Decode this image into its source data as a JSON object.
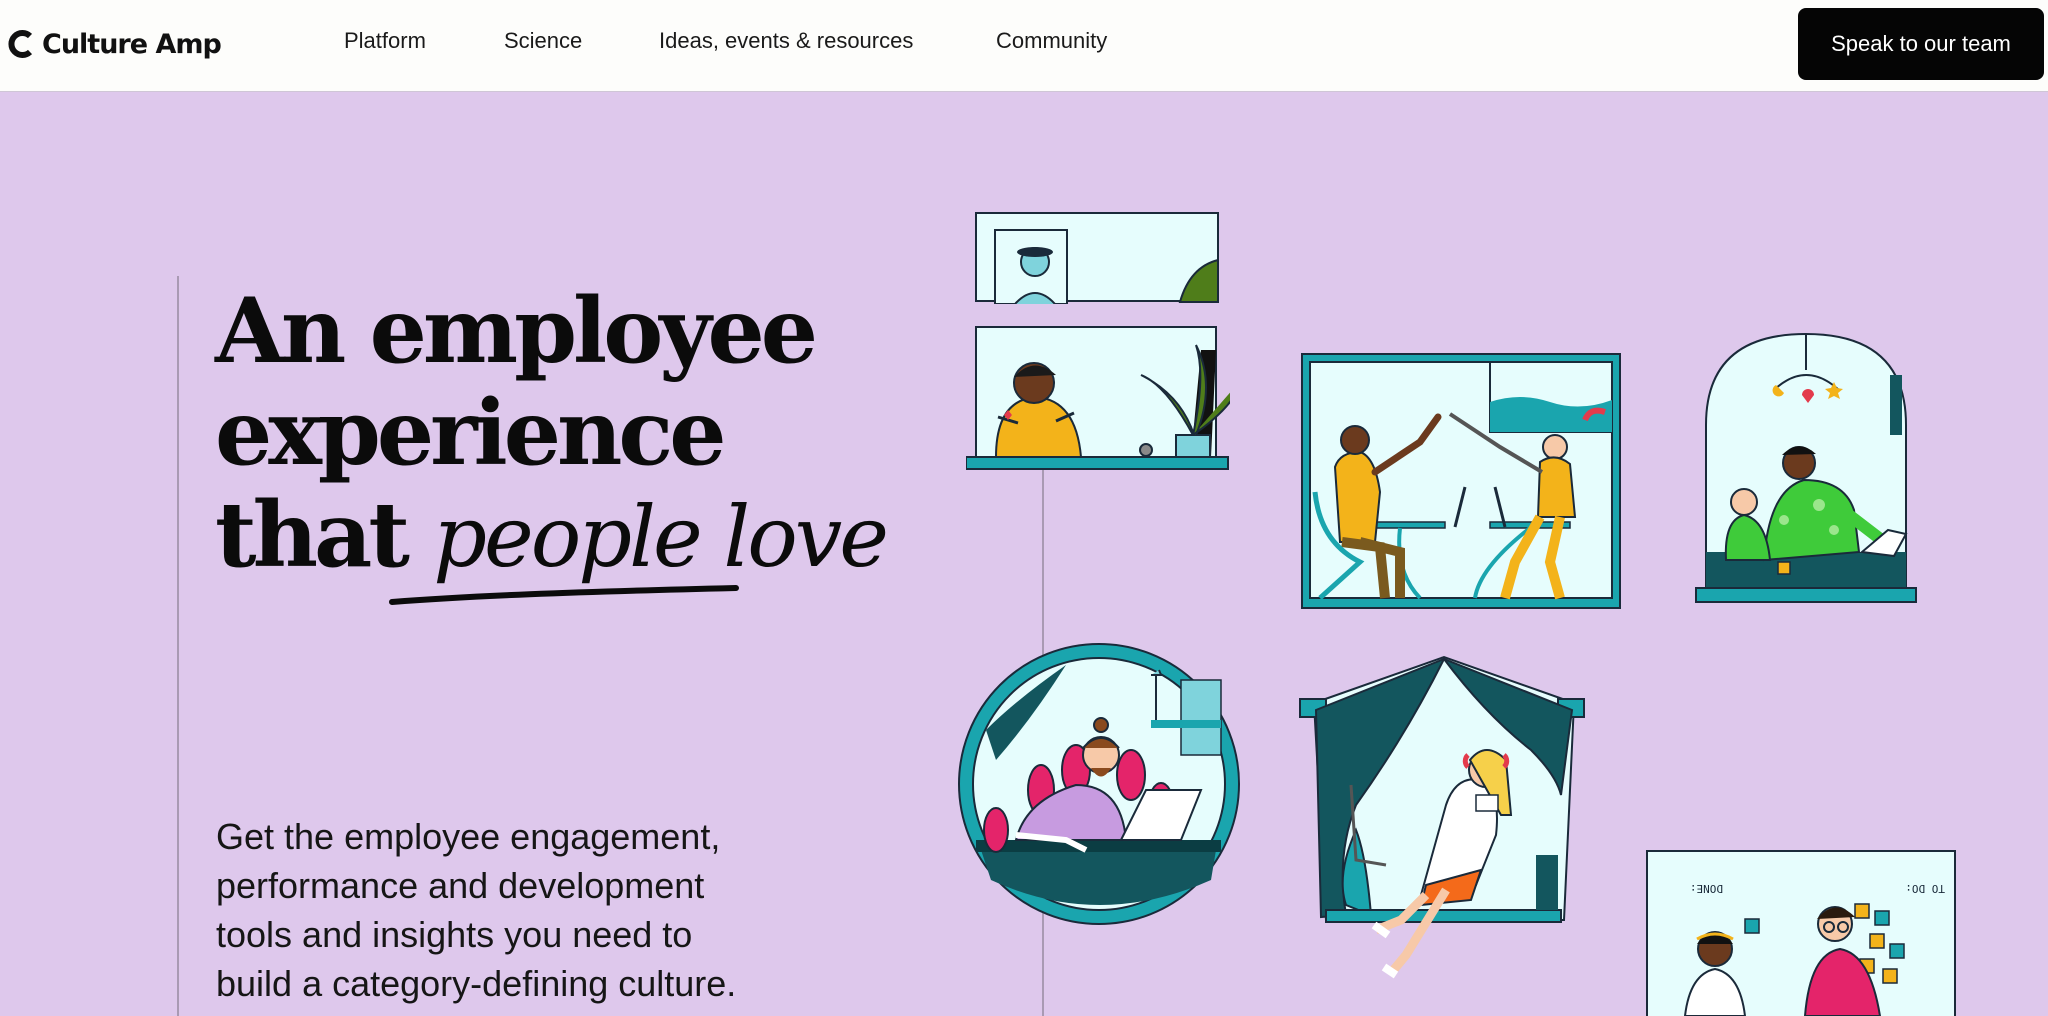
{
  "brand": {
    "name": "Culture Amp"
  },
  "nav": {
    "items": [
      {
        "label": "Platform"
      },
      {
        "label": "Science"
      },
      {
        "label": "Ideas, events & resources"
      },
      {
        "label": "Community"
      }
    ],
    "cta_label": "Speak to our team"
  },
  "hero": {
    "headline_line1": "An employee",
    "headline_line2": "experience",
    "headline_line3_plain": "that",
    "headline_line3_script": "people love",
    "subtitle_lines": [
      "Get the employee engagement,",
      "performance and development",
      "tools and insights you need to",
      "build a category-defining culture."
    ]
  },
  "illustrations": {
    "todo_label": "TO DO:",
    "done_label": "DONE:"
  },
  "colors": {
    "background": "#dec8ec",
    "nav_background": "#fdfdfb",
    "cta_background": "#050505",
    "teal": "#1aa5ae",
    "dark_teal": "#13565e",
    "pale_cyan": "#e6fdfd"
  }
}
